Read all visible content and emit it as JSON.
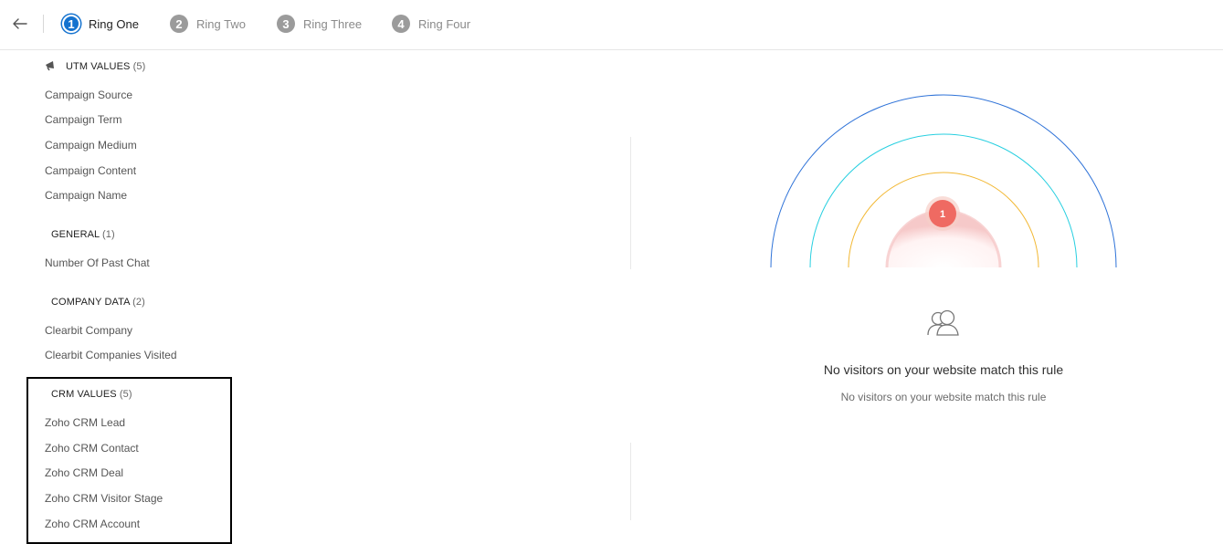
{
  "steps": [
    {
      "number": "1",
      "label": "Ring One"
    },
    {
      "number": "2",
      "label": "Ring Two"
    },
    {
      "number": "3",
      "label": "Ring Three"
    },
    {
      "number": "4",
      "label": "Ring Four"
    }
  ],
  "sections": {
    "utm": {
      "title": "UTM VALUES",
      "count": "(5)",
      "items": [
        "Campaign Source",
        "Campaign Term",
        "Campaign Medium",
        "Campaign Content",
        "Campaign Name"
      ]
    },
    "general": {
      "title": "GENERAL",
      "count": "(1)",
      "items": [
        "Number Of Past Chat"
      ]
    },
    "company": {
      "title": "COMPANY DATA",
      "count": "(2)",
      "items": [
        "Clearbit Company",
        "Clearbit Companies Visited"
      ]
    },
    "crm": {
      "title": "CRM VALUES",
      "count": "(5)",
      "items": [
        "Zoho CRM Lead",
        "Zoho CRM Contact",
        "Zoho CRM Deal",
        "Zoho CRM Visitor Stage",
        "Zoho CRM Account"
      ]
    }
  },
  "rings": {
    "marker_count": "1",
    "colors": {
      "outer": "#2f73d8",
      "middle": "#27cfe0",
      "inner": "#f2b834",
      "core": "#f6c9c9",
      "marker": "#ef6a62"
    }
  },
  "empty_state": {
    "title": "No visitors on your website match this rule",
    "subtitle": "No visitors on your website match this rule",
    "icon": "users-icon"
  },
  "accent_color": "#1472cf"
}
